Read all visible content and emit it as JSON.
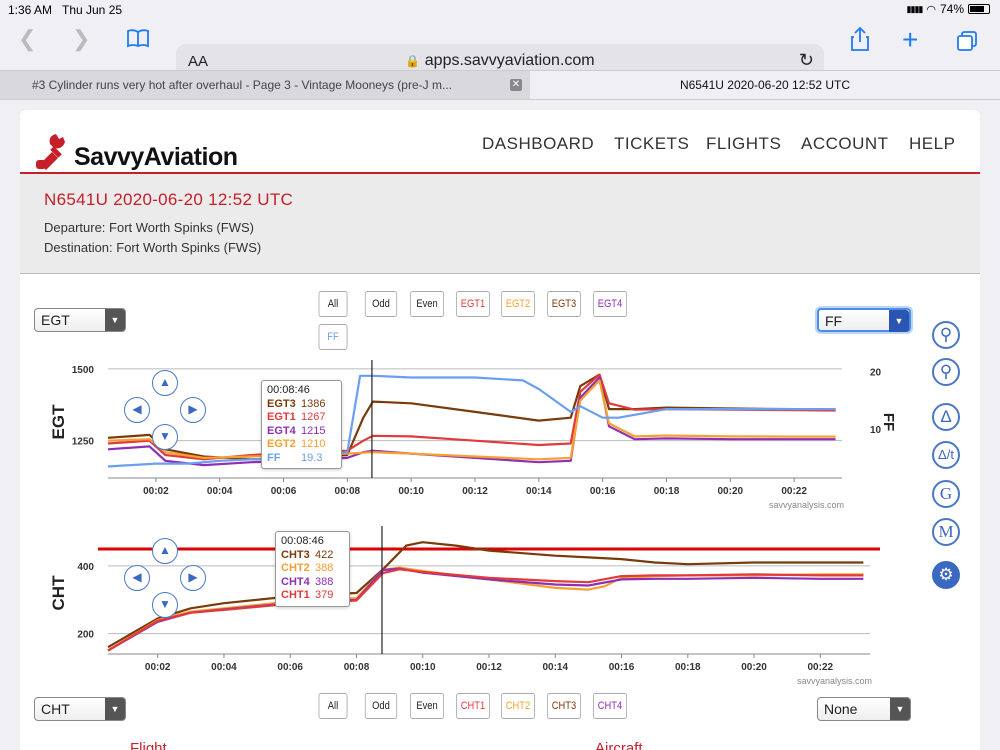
{
  "status": {
    "time": "1:36 AM",
    "date": "Thu Jun 25",
    "battery": "74%"
  },
  "browser": {
    "text_size": "AA",
    "url": "apps.savvyaviation.com",
    "tabs": [
      {
        "label": "#3 Cylinder runs very hot after overhaul - Page 3 - Vintage Mooneys (pre-J m..."
      },
      {
        "label": "N6541U 2020-06-20 12:52 UTC"
      }
    ]
  },
  "site": {
    "logo": "SavvyAviation",
    "nav": [
      "DASHBOARD",
      "TICKETS",
      "FLIGHTS",
      "ACCOUNT",
      "HELP"
    ]
  },
  "flight": {
    "title": "N6541U 2020-06-20 12:52 UTC",
    "departure": "Departure: Fort Worth Spinks (FWS)",
    "destination": "Destination: Fort Worth Spinks (FWS)"
  },
  "egt_chart_controls": {
    "left_select": "EGT",
    "right_select": "FF",
    "buttons": [
      "All",
      "Odd",
      "Even",
      "EGT1",
      "EGT2",
      "EGT3",
      "EGT4",
      "FF"
    ]
  },
  "cht_chart_controls": {
    "left_select": "CHT",
    "right_select": "None",
    "buttons": [
      "All",
      "Odd",
      "Even",
      "CHT1",
      "CHT2",
      "CHT3",
      "CHT4"
    ]
  },
  "colors": {
    "egt1": "#e03a3a",
    "egt2": "#f5a030",
    "egt3": "#7a3b0a",
    "egt4": "#8e2fb5",
    "ff": "#6b9ef0",
    "cht1": "#e03a3a",
    "cht2": "#f5a030",
    "cht3": "#7a3b0a",
    "cht4": "#8e2fb5",
    "limit": "#dd0000",
    "brand": "#c61f2a"
  },
  "side_tools": [
    "zoom-in-icon",
    "zoom-out-icon",
    "delta-icon",
    "delta-t-icon",
    "g-icon",
    "m-icon",
    "gear-icon"
  ],
  "chart_data": [
    {
      "type": "line",
      "ylabel": "EGT",
      "y2label": "FF",
      "yticks": [
        1250,
        1500
      ],
      "y2ticks": [
        10,
        20
      ],
      "ylim": [
        1120,
        1510
      ],
      "y2lim": [
        1.5,
        21.0
      ],
      "xticks": [
        "00:02",
        "00:04",
        "00:06",
        "00:08",
        "00:10",
        "00:12",
        "00:14",
        "00:16",
        "00:18",
        "00:20",
        "00:22"
      ],
      "xlim_min": [
        0.5,
        23.5
      ],
      "watermark": "savvyanalysis.com",
      "cursor": {
        "time": "00:08:46",
        "t": 8.77
      },
      "tooltip": [
        {
          "label": "EGT3",
          "value": "1386"
        },
        {
          "label": "EGT1",
          "value": "1267"
        },
        {
          "label": "EGT4",
          "value": "1215"
        },
        {
          "label": "EGT2",
          "value": "1210"
        },
        {
          "label": "FF",
          "value": "19.3"
        }
      ],
      "series": [
        {
          "name": "EGT3",
          "axis": "left",
          "points": [
            [
              0.5,
              1260
            ],
            [
              1.8,
              1270
            ],
            [
              2.3,
              1220
            ],
            [
              3.5,
              1195
            ],
            [
              5,
              1185
            ],
            [
              6.5,
              1190
            ],
            [
              8,
              1200
            ],
            [
              8.5,
              1330
            ],
            [
              8.8,
              1386
            ],
            [
              10,
              1380
            ],
            [
              12,
              1350
            ],
            [
              14,
              1320
            ],
            [
              15,
              1330
            ],
            [
              15.3,
              1440
            ],
            [
              15.9,
              1480
            ],
            [
              16.2,
              1360
            ],
            [
              17,
              1360
            ],
            [
              18,
              1365
            ],
            [
              20,
              1362
            ],
            [
              22,
              1360
            ],
            [
              23.3,
              1358
            ]
          ]
        },
        {
          "name": "EGT1",
          "axis": "left",
          "points": [
            [
              0.5,
              1240
            ],
            [
              1.8,
              1250
            ],
            [
              2.3,
              1200
            ],
            [
              3.5,
              1185
            ],
            [
              5,
              1200
            ],
            [
              6.5,
              1210
            ],
            [
              8,
              1215
            ],
            [
              8.5,
              1250
            ],
            [
              8.8,
              1267
            ],
            [
              10,
              1265
            ],
            [
              12,
              1250
            ],
            [
              14,
              1235
            ],
            [
              15,
              1240
            ],
            [
              15.3,
              1420
            ],
            [
              15.9,
              1480
            ],
            [
              16.2,
              1380
            ],
            [
              17,
              1358
            ],
            [
              18,
              1360
            ],
            [
              20,
              1358
            ],
            [
              22,
              1356
            ],
            [
              23.3,
              1355
            ]
          ]
        },
        {
          "name": "EGT4",
          "axis": "left",
          "points": [
            [
              0.5,
              1220
            ],
            [
              1.8,
              1230
            ],
            [
              2.3,
              1180
            ],
            [
              3.5,
              1165
            ],
            [
              5,
              1175
            ],
            [
              6.5,
              1180
            ],
            [
              8,
              1190
            ],
            [
              8.5,
              1210
            ],
            [
              8.8,
              1215
            ],
            [
              10,
              1205
            ],
            [
              12,
              1190
            ],
            [
              14,
              1175
            ],
            [
              15,
              1180
            ],
            [
              15.3,
              1400
            ],
            [
              15.9,
              1470
            ],
            [
              16.2,
              1300
            ],
            [
              17,
              1255
            ],
            [
              18,
              1258
            ],
            [
              20,
              1255
            ],
            [
              22,
              1255
            ],
            [
              23.3,
              1255
            ]
          ]
        },
        {
          "name": "EGT2",
          "axis": "left",
          "points": [
            [
              0.5,
              1250
            ],
            [
              1.8,
              1255
            ],
            [
              2.3,
              1210
            ],
            [
              3.5,
              1190
            ],
            [
              5,
              1195
            ],
            [
              6.5,
              1200
            ],
            [
              8,
              1205
            ],
            [
              8.5,
              1208
            ],
            [
              8.8,
              1210
            ],
            [
              10,
              1205
            ],
            [
              12,
              1195
            ],
            [
              14,
              1185
            ],
            [
              15,
              1190
            ],
            [
              15.3,
              1390
            ],
            [
              15.9,
              1460
            ],
            [
              16.2,
              1310
            ],
            [
              17,
              1265
            ],
            [
              18,
              1268
            ],
            [
              20,
              1265
            ],
            [
              22,
              1264
            ],
            [
              23.3,
              1264
            ]
          ]
        },
        {
          "name": "FF",
          "axis": "right",
          "points": [
            [
              0.5,
              3.5
            ],
            [
              2,
              4
            ],
            [
              3,
              4
            ],
            [
              4,
              4.5
            ],
            [
              6,
              5
            ],
            [
              8,
              6
            ],
            [
              8.4,
              19.3
            ],
            [
              8.8,
              19.3
            ],
            [
              10,
              19
            ],
            [
              12,
              19
            ],
            [
              13.5,
              18.5
            ],
            [
              14,
              17
            ],
            [
              15,
              13
            ],
            [
              15.3,
              14
            ],
            [
              16,
              12
            ],
            [
              16.5,
              12
            ],
            [
              17,
              12.5
            ],
            [
              18,
              13.5
            ],
            [
              20,
              13.5
            ],
            [
              22,
              13.5
            ],
            [
              23.3,
              13.5
            ]
          ]
        }
      ]
    },
    {
      "type": "line",
      "ylabel": "CHT",
      "y2label": "None",
      "yticks": [
        200,
        400
      ],
      "ylim": [
        140,
        500
      ],
      "limit_line": 450,
      "xticks": [
        "00:02",
        "00:04",
        "00:06",
        "00:08",
        "00:10",
        "00:12",
        "00:14",
        "00:16",
        "00:18",
        "00:20",
        "00:22"
      ],
      "xlim_min": [
        0.5,
        23.5
      ],
      "watermark": "savvyanalysis.com",
      "cursor": {
        "time": "00:08:46",
        "t": 8.77
      },
      "tooltip": [
        {
          "label": "CHT3",
          "value": "422"
        },
        {
          "label": "CHT2",
          "value": "388"
        },
        {
          "label": "CHT4",
          "value": "388"
        },
        {
          "label": "CHT1",
          "value": "379"
        }
      ],
      "series": [
        {
          "name": "CHT3",
          "points": [
            [
              0.5,
              160
            ],
            [
              2,
              245
            ],
            [
              3,
              275
            ],
            [
              4,
              290
            ],
            [
              6,
              310
            ],
            [
              8,
              320
            ],
            [
              8.8,
              390
            ],
            [
              9.5,
              460
            ],
            [
              10,
              470
            ],
            [
              11,
              460
            ],
            [
              12,
              445
            ],
            [
              14,
              430
            ],
            [
              15,
              425
            ],
            [
              16,
              420
            ],
            [
              17,
              410
            ],
            [
              18,
              405
            ],
            [
              20,
              410
            ],
            [
              22,
              410
            ],
            [
              23.3,
              410
            ]
          ]
        },
        {
          "name": "CHT2",
          "points": [
            [
              0.5,
              150
            ],
            [
              2,
              240
            ],
            [
              3,
              265
            ],
            [
              4,
              275
            ],
            [
              6,
              295
            ],
            [
              8,
              305
            ],
            [
              8.8,
              388
            ],
            [
              9.3,
              395
            ],
            [
              10,
              385
            ],
            [
              12,
              360
            ],
            [
              14,
              335
            ],
            [
              15,
              330
            ],
            [
              15.5,
              340
            ],
            [
              16,
              365
            ],
            [
              17,
              370
            ],
            [
              18,
              372
            ],
            [
              20,
              372
            ],
            [
              22,
              375
            ],
            [
              23.3,
              375
            ]
          ]
        },
        {
          "name": "CHT4",
          "points": [
            [
              0.5,
              150
            ],
            [
              2,
              235
            ],
            [
              3,
              262
            ],
            [
              4,
              272
            ],
            [
              6,
              290
            ],
            [
              8,
              300
            ],
            [
              8.8,
              388
            ],
            [
              9.3,
              392
            ],
            [
              10,
              380
            ],
            [
              12,
              360
            ],
            [
              14,
              345
            ],
            [
              15,
              342
            ],
            [
              16,
              360
            ],
            [
              17,
              362
            ],
            [
              18,
              362
            ],
            [
              20,
              365
            ],
            [
              22,
              362
            ],
            [
              23.3,
              362
            ]
          ]
        },
        {
          "name": "CHT1",
          "points": [
            [
              0.5,
              150
            ],
            [
              2,
              238
            ],
            [
              3,
              262
            ],
            [
              4,
              270
            ],
            [
              6,
              288
            ],
            [
              8,
              298
            ],
            [
              8.8,
              379
            ],
            [
              9.3,
              390
            ],
            [
              10,
              382
            ],
            [
              12,
              365
            ],
            [
              14,
              355
            ],
            [
              15,
              352
            ],
            [
              16,
              370
            ],
            [
              17,
              372
            ],
            [
              18,
              372
            ],
            [
              20,
              375
            ],
            [
              22,
              372
            ],
            [
              23.3,
              372
            ]
          ]
        }
      ]
    }
  ],
  "bottom_sections": {
    "left": "Flight",
    "right": "Aircraft"
  }
}
